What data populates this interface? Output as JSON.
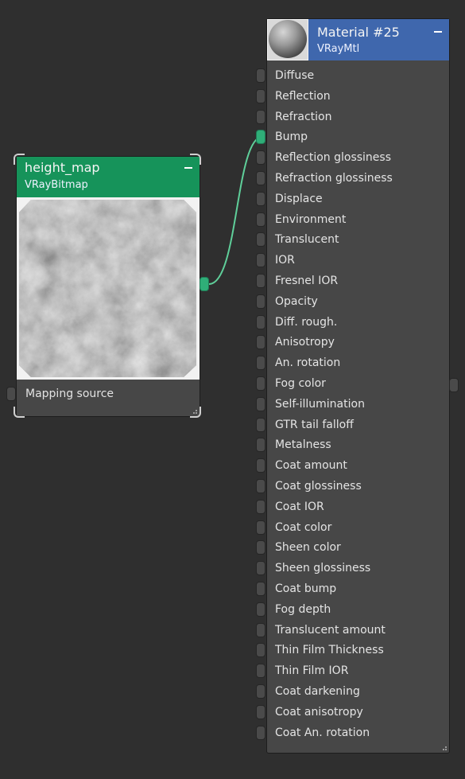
{
  "bitmap_node": {
    "title": "height_map",
    "subtitle": "VRayBitmap",
    "header_color": "#16935a",
    "input_label": "Mapping source",
    "collapse_icon": "minus-icon",
    "preview_icon": "texture-preview"
  },
  "material_node": {
    "title": "Material #25",
    "subtitle": "VRayMtl",
    "header_color": "#3f67ad",
    "collapse_icon": "minus-icon",
    "preview_icon": "material-sphere-preview",
    "slots": [
      {
        "label": "Diffuse"
      },
      {
        "label": "Reflection"
      },
      {
        "label": "Refraction"
      },
      {
        "label": "Bump",
        "connected": true
      },
      {
        "label": "Reflection glossiness"
      },
      {
        "label": "Refraction glossiness"
      },
      {
        "label": "Displace"
      },
      {
        "label": "Environment"
      },
      {
        "label": "Translucent"
      },
      {
        "label": "IOR"
      },
      {
        "label": "Fresnel IOR"
      },
      {
        "label": "Opacity"
      },
      {
        "label": "Diff. rough."
      },
      {
        "label": "Anisotropy"
      },
      {
        "label": "An. rotation"
      },
      {
        "label": "Fog color"
      },
      {
        "label": "Self-illumination"
      },
      {
        "label": "GTR tail falloff"
      },
      {
        "label": "Metalness"
      },
      {
        "label": "Coat amount"
      },
      {
        "label": "Coat glossiness"
      },
      {
        "label": "Coat IOR"
      },
      {
        "label": "Coat color"
      },
      {
        "label": "Sheen color"
      },
      {
        "label": "Sheen glossiness"
      },
      {
        "label": "Coat bump"
      },
      {
        "label": "Fog depth"
      },
      {
        "label": "Translucent amount"
      },
      {
        "label": "Thin Film Thickness"
      },
      {
        "label": "Thin Film IOR"
      },
      {
        "label": "Coat darkening"
      },
      {
        "label": "Coat anisotropy"
      },
      {
        "label": "Coat An. rotation"
      }
    ]
  },
  "wire_color": "#5fcf9a"
}
